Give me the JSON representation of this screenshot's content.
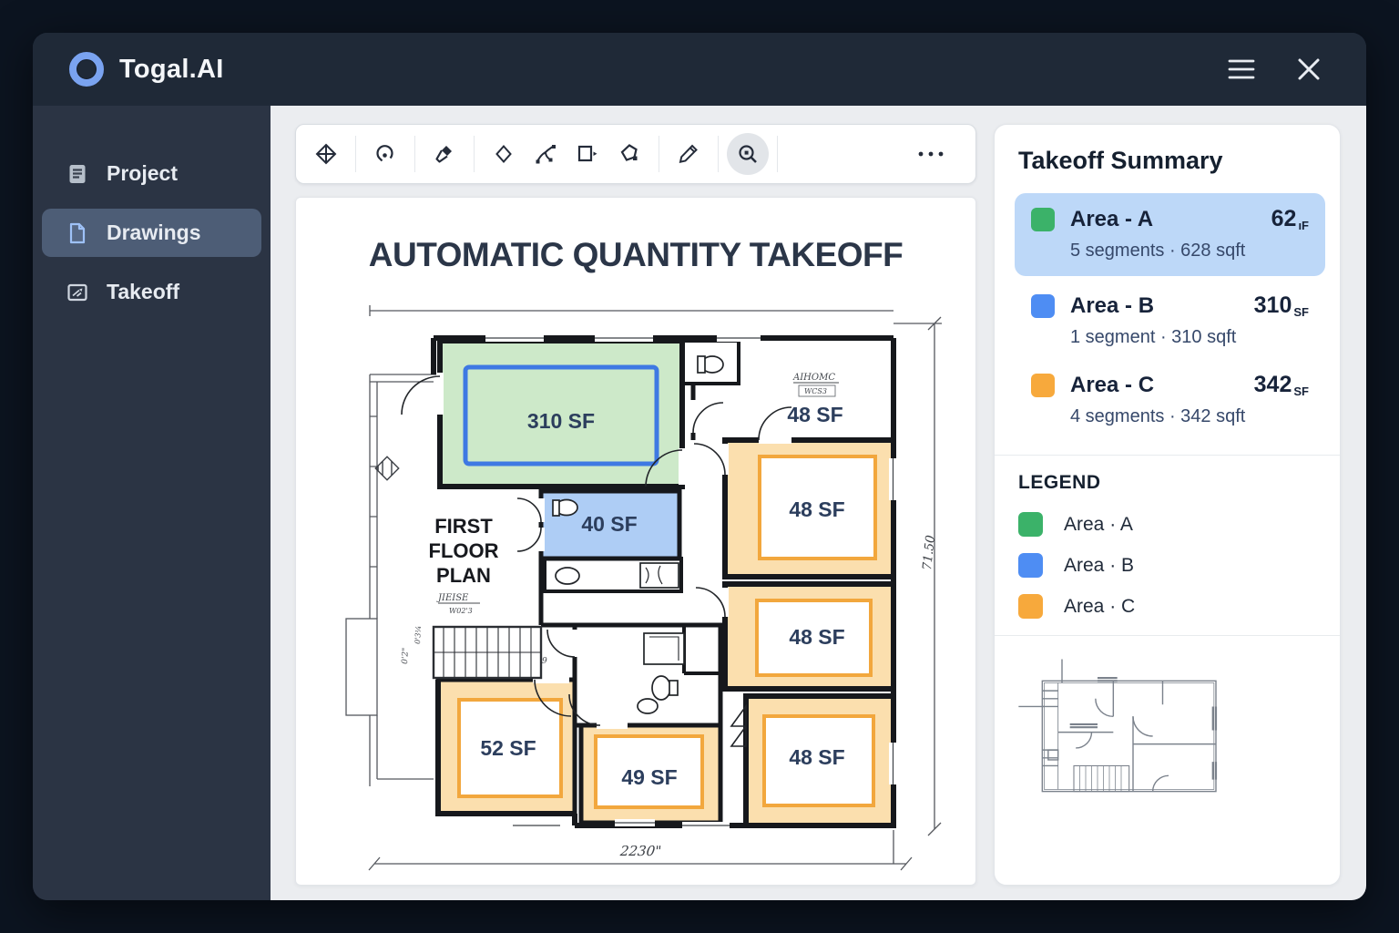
{
  "window": {
    "title": "Togal.AI"
  },
  "sidebar": {
    "items": [
      {
        "label": "Project"
      },
      {
        "label": "Drawings"
      },
      {
        "label": "Takeoff"
      }
    ]
  },
  "toolbar": {
    "tools": [
      "compass-diamond",
      "lasso",
      "marker",
      "diamond",
      "split-path",
      "rectangle-select",
      "polygon",
      "pencil",
      "zoom-search",
      "more"
    ],
    "active_tool": "zoom-search"
  },
  "canvas": {
    "title": "AUTOMATIC QUANTITY TAKEOFF",
    "plan_title_lines": [
      "FIRST",
      "FLOOR",
      "PLAN"
    ],
    "room_labels": [
      "310 SF",
      "40 SF",
      "48 SF",
      "48 SF",
      "48 SF",
      "48 SF",
      "52 SF",
      "49 SF"
    ],
    "dimensions": {
      "right": "71.50",
      "bottom": "2230\""
    },
    "annotations": {
      "top_room": "AIHOMC",
      "top_room_sub": "WCS3",
      "stairs": "JIEISE",
      "stairs_sub": "W02'3",
      "stair_dim_a": "0'2\"",
      "stair_dim_b": "0'3¼",
      "stair_count": "9"
    },
    "plan_colors": {
      "area_a_fill": "#cde9c9",
      "area_a_outline": "#3e79e3",
      "area_b_fill": "#aecdf5",
      "area_c_fill": "#fbdfae",
      "area_c_outline": "#f2a73d"
    }
  },
  "summary": {
    "heading": "Takeoff Summary",
    "areas": [
      {
        "name": "Area - A",
        "value": "62",
        "unit": "ıF",
        "detail": "5 segments · 628 sqft",
        "color": "#3bb269",
        "selected": true
      },
      {
        "name": "Area - B",
        "value": "310",
        "unit": "SF",
        "detail": "1 segment · 310 sqft",
        "color": "#4e8df3",
        "selected": false
      },
      {
        "name": "Area - C",
        "value": "342",
        "unit": "SF",
        "detail": "4 segments · 342 sqft",
        "color": "#f7a93c",
        "selected": false
      }
    ],
    "selected_bg": "#bdd8f8",
    "legend": {
      "heading": "LEGEND",
      "items": [
        {
          "label": "Area · A",
          "color": "#3bb269"
        },
        {
          "label": "Area · B",
          "color": "#4e8df3"
        },
        {
          "label": "Area · C",
          "color": "#f7a93c"
        }
      ]
    }
  }
}
